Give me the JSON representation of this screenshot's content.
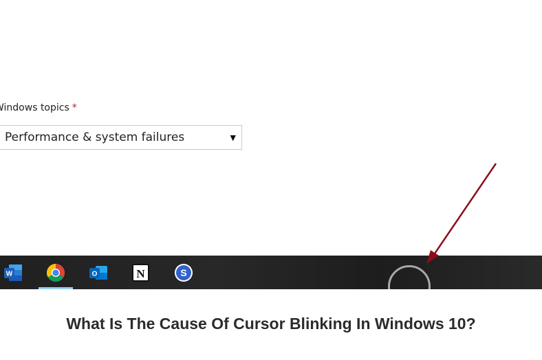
{
  "form": {
    "topics_label": "Windows topics",
    "required_mark": "*",
    "selected_topic": "Performance & system failures"
  },
  "taskbar": {
    "apps": [
      {
        "name": "Microsoft Word",
        "icon": "word-icon",
        "glyph": "W"
      },
      {
        "name": "Google Chrome",
        "icon": "chrome-icon",
        "active": true
      },
      {
        "name": "Microsoft Outlook",
        "icon": "outlook-icon",
        "glyph": "O"
      },
      {
        "name": "Notion",
        "icon": "notion-icon",
        "glyph": "N"
      },
      {
        "name": "Simplenote",
        "icon": "simplenote-icon",
        "glyph": "S"
      }
    ],
    "highlight": "search-ring"
  },
  "annotation": {
    "arrow_color": "#8b0d1a"
  },
  "article": {
    "headline": "What Is The Cause Of Cursor Blinking In Windows 10?"
  }
}
